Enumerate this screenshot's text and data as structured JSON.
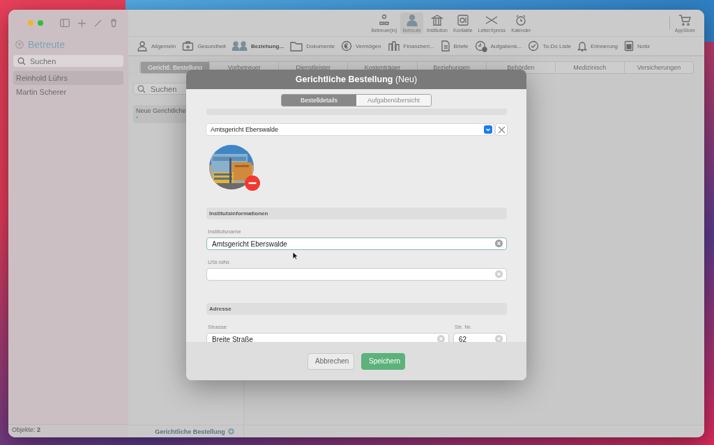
{
  "sidebar": {
    "title": "Betreute",
    "search": {
      "placeholder": "Suchen"
    },
    "items": [
      {
        "label": "Reinhold Lührs",
        "selected": true
      },
      {
        "label": "Martin Scherer",
        "selected": false
      }
    ],
    "status": {
      "label": "Objekte:",
      "count": "2"
    }
  },
  "toolbar": {
    "items": [
      {
        "label": "Betreuer(in)",
        "selected": false
      },
      {
        "label": "Betreute",
        "selected": true
      },
      {
        "label": "Institution",
        "selected": false
      },
      {
        "label": "Kontakte",
        "selected": false
      },
      {
        "label": "LetterXpress",
        "selected": false
      },
      {
        "label": "Kalender",
        "selected": false
      }
    ],
    "store": {
      "label": "AppStore"
    }
  },
  "categories": [
    {
      "label": "Allgemein",
      "selected": false
    },
    {
      "label": "Gesundheit",
      "selected": false
    },
    {
      "label": "Beziehung...",
      "selected": true
    },
    {
      "label": "Dokumente",
      "selected": false
    },
    {
      "label": "Vermögen",
      "selected": false
    },
    {
      "label": "Finanzberi...",
      "selected": false
    },
    {
      "label": "Briefe",
      "selected": false
    },
    {
      "label": "Aufgabenk...",
      "selected": false
    },
    {
      "label": "To-Do Liste",
      "selected": false
    },
    {
      "label": "Erinnerung",
      "selected": false
    },
    {
      "label": "Notiz",
      "selected": false
    }
  ],
  "tabs": [
    {
      "label": "Gerichtl. Bestellung",
      "selected": true
    },
    {
      "label": "Vorbetreuer",
      "selected": false
    },
    {
      "label": "Dienstleister",
      "selected": false
    },
    {
      "label": "Kostenträger",
      "selected": false
    },
    {
      "label": "Beziehungen",
      "selected": false
    },
    {
      "label": "Behörden",
      "selected": false
    },
    {
      "label": "Medizinisch",
      "selected": false
    },
    {
      "label": "Versicherungen",
      "selected": false
    }
  ],
  "list": {
    "search": {
      "placeholder": "Suchen"
    },
    "items": [
      {
        "label": "Neue Gerichtliche"
      }
    ],
    "footer": "Gerichtliche Bestellung"
  },
  "dialog": {
    "title": "**Gerichtliche Bestellung** (Neu)",
    "tabs": [
      {
        "label": "Bestelldetails",
        "selected": true
      },
      {
        "label": "Aufgabenübersicht",
        "selected": false
      }
    ],
    "relation": {
      "value": "Amtsgericht Eberswalde"
    },
    "institution": {
      "heading": "Institutsinformationen",
      "fields": [
        {
          "label": "Institutsname",
          "value": "Amtsgericht Eberswalde",
          "focused": true
        },
        {
          "label": "USt-IdNr.",
          "focused": false
        }
      ]
    },
    "address": {
      "heading": "Adresse",
      "fields": [
        {
          "label": "Strasse",
          "value": "Breite Straße"
        },
        {
          "label": "Str. Nr.",
          "value": "62"
        }
      ]
    },
    "buttons": [
      {
        "label": "Abbrechen",
        "kind": "secondary"
      },
      {
        "label": "Speichern",
        "kind": "primary"
      }
    ]
  }
}
